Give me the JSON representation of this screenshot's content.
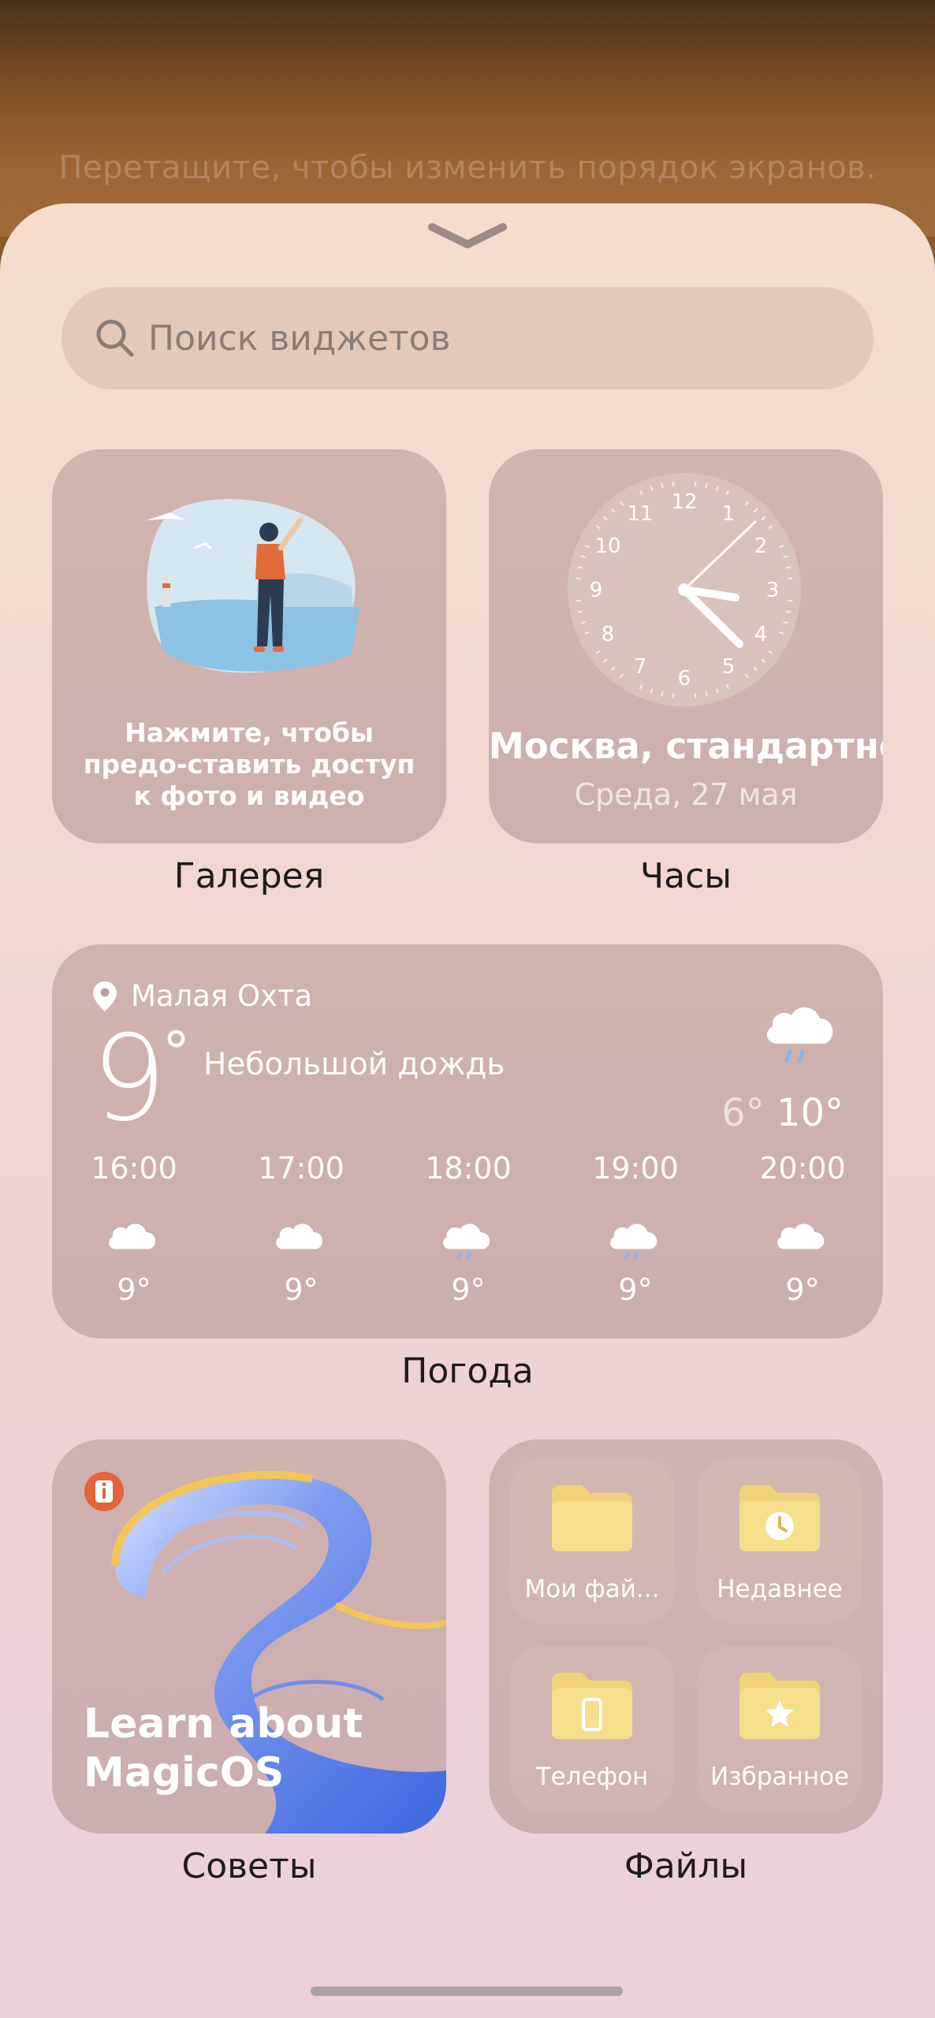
{
  "hint": "Перетащите, чтобы изменить порядок экранов.",
  "search": {
    "placeholder": "Поиск виджетов"
  },
  "gallery": {
    "text": "Нажмите, чтобы предо-ставить доступ к фото и видео",
    "label": "Галерея"
  },
  "clock": {
    "numbers": [
      "12",
      "1",
      "2",
      "3",
      "4",
      "5",
      "6",
      "7",
      "8",
      "9",
      "10",
      "11"
    ],
    "city": "Москва, стандартно..",
    "date": "Среда, 27 мая",
    "label": "Часы"
  },
  "weather": {
    "location": "Малая Охта",
    "temp": "9",
    "degree": "°",
    "description": "Небольшой дождь",
    "low": "6°",
    "high": "10°",
    "hours": [
      {
        "time": "16:00",
        "temp": "9°",
        "icon": "cloud-icon"
      },
      {
        "time": "17:00",
        "temp": "9°",
        "icon": "cloud-icon"
      },
      {
        "time": "18:00",
        "temp": "9°",
        "icon": "rain-cloud-icon"
      },
      {
        "time": "19:00",
        "temp": "9°",
        "icon": "rain-cloud-icon"
      },
      {
        "time": "20:00",
        "temp": "9°",
        "icon": "cloud-icon"
      }
    ],
    "label": "Погода"
  },
  "tips": {
    "line1": "Learn about",
    "line2": "MagicOS",
    "label": "Советы"
  },
  "files": {
    "tiles": [
      "Мои фай...",
      "Недавнее",
      "Телефон",
      "Избранное"
    ],
    "label": "Файлы"
  }
}
